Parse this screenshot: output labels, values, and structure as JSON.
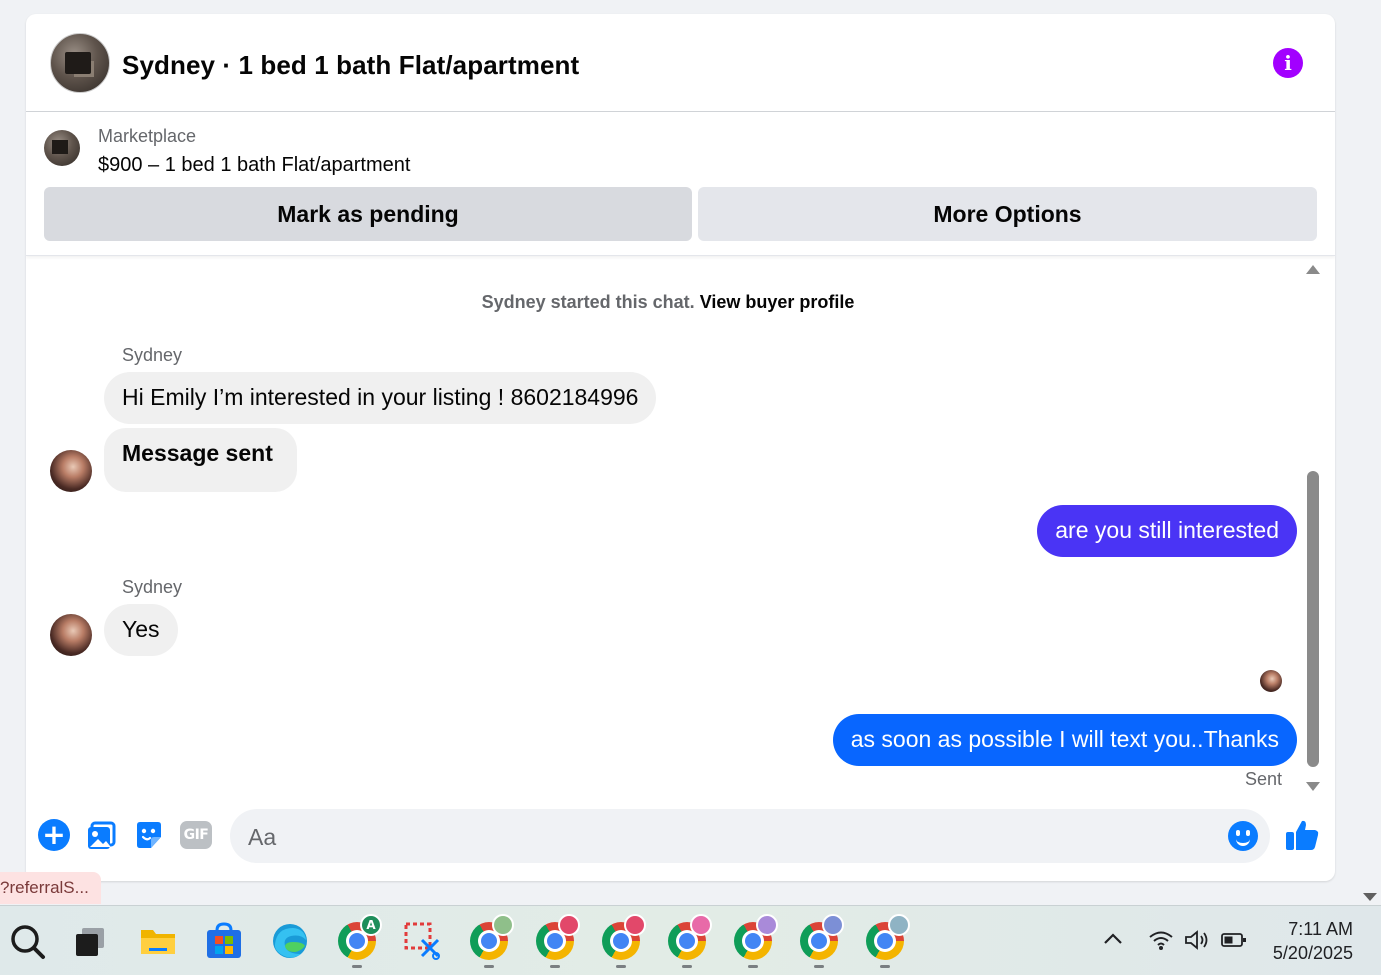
{
  "header": {
    "title": "Sydney · 1 bed 1 bath Flat/apartment",
    "info_glyph": "i"
  },
  "listing": {
    "kicker": "Marketplace",
    "price_line": "$900 – 1 bed 1 bath Flat/apartment",
    "mark_pending_label": "Mark as pending",
    "more_options_label": "More Options"
  },
  "chat": {
    "started_text": "Sydney started this chat.",
    "view_profile_link": "View buyer profile",
    "messages": [
      {
        "from": "Sydney",
        "direction": "in",
        "sender_label": "Sydney",
        "text": "Hi Emily I’m interested in your listing ! 8602184996"
      },
      {
        "from": "Sydney",
        "direction": "in",
        "text": "Message sent"
      },
      {
        "from": "me",
        "direction": "out",
        "text": "are you still interested",
        "color": "#4a34f5"
      },
      {
        "from": "Sydney",
        "direction": "in",
        "sender_label": "Sydney",
        "text": "Yes"
      },
      {
        "from": "me",
        "direction": "out",
        "text": "as soon as possible I will text you..Thanks",
        "color": "#0866ff"
      }
    ],
    "sent_status": "Sent"
  },
  "composer": {
    "placeholder": "Aa",
    "gif_label": "GIF",
    "plus_glyph": "+",
    "icons": [
      "plus-circle-icon",
      "photo-icon",
      "sticker-icon",
      "gif-icon",
      "emoji-icon",
      "thumbs-up-icon"
    ]
  },
  "status_url_tip": "?referralS...",
  "taskbar": {
    "icons": [
      "search-icon",
      "task-view-icon",
      "file-explorer-icon",
      "microsoft-store-icon",
      "edge-icon",
      "chrome-icon",
      "snipping-tool-icon",
      "chrome-icon",
      "chrome-icon",
      "chrome-icon",
      "chrome-icon",
      "chrome-icon",
      "chrome-icon",
      "chrome-icon"
    ],
    "chrome_profile_badge": "A",
    "tray_chevron": "^",
    "time": "7:11 AM",
    "date": "5/20/2025"
  },
  "colors": {
    "accent_blue": "#0866ff",
    "accent_indigo": "#4a34f5",
    "info_purple": "#a200ff"
  }
}
